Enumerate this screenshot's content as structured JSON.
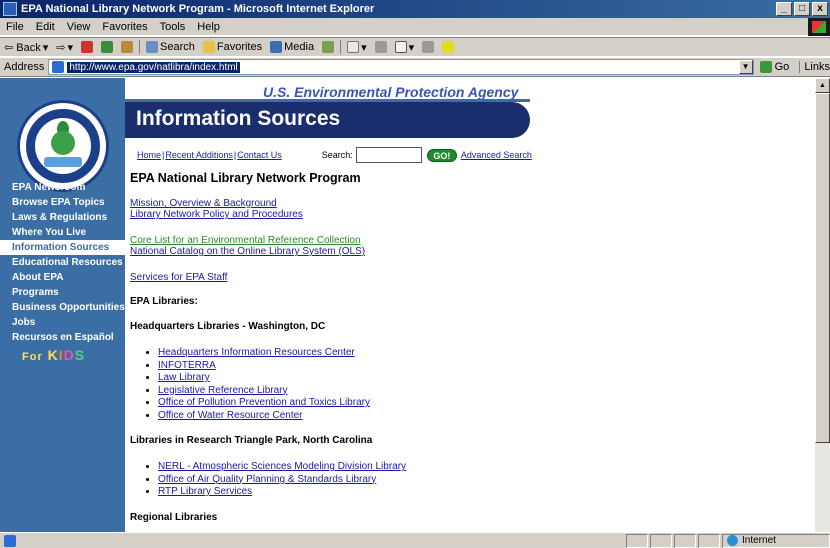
{
  "window": {
    "title": "EPA National Library Network Program - Microsoft Internet Explorer",
    "controls": [
      "_",
      "□",
      "x"
    ]
  },
  "menu": [
    "File",
    "Edit",
    "View",
    "Favorites",
    "Tools",
    "Help"
  ],
  "toolbar": {
    "back": "⇦ Back",
    "forward": "⇨",
    "search": "Search",
    "favorites": "Favorites",
    "media": "Media"
  },
  "address": {
    "label": "Address",
    "url": "http://www.epa.gov/natlibra/index.html",
    "go": "Go",
    "links": "Links"
  },
  "site": {
    "agency": "U.S. Environmental Protection Agency",
    "banner": "Information Sources",
    "topnav": [
      "Home",
      "Recent Additions",
      "Contact Us"
    ],
    "search_label": "Search:",
    "search_value": "",
    "go_button": "GO!",
    "advanced_search": "Advanced Search",
    "kids_prefix": "For",
    "kids_word": "KIDS"
  },
  "sidebar": {
    "items": [
      {
        "label": "EPA Newsroom"
      },
      {
        "label": "Browse EPA Topics"
      },
      {
        "label": "Laws & Regulations"
      },
      {
        "label": "Where You Live"
      },
      {
        "label": "Information Sources"
      },
      {
        "label": "Educational Resources"
      },
      {
        "label": "About EPA"
      },
      {
        "label": "Programs"
      },
      {
        "label": "Business Opportunities"
      },
      {
        "label": "Jobs"
      },
      {
        "label": "Recursos en Español"
      }
    ]
  },
  "main": {
    "title": "EPA National Library Network Program",
    "links_a": [
      "Mission, Overview & Background",
      "Library Network Policy and Procedures"
    ],
    "links_b": [
      "Core List for an Environmental Reference Collection",
      "National Catalog on the Online Library System (OLS)"
    ],
    "services": "Services for EPA Staff",
    "libraries_heading": "EPA Libraries:",
    "hq_heading": "Headquarters Libraries - Washington, DC",
    "hq_list": [
      "Headquarters Information Resources Center",
      "INFOTERRA",
      "Law Library",
      "Legislative Reference Library",
      "Office of Pollution Prevention and Toxics Library",
      "Office of Water Resource Center"
    ],
    "rtp_heading": "Libraries in Research Triangle Park, North Carolina",
    "rtp_list": [
      "NERL - Atmospheric Sciences Modeling Division Library",
      "Office of Air Quality Planning & Standards Library",
      "RTP Library Services"
    ],
    "regional_heading": "Regional Libraries"
  },
  "status": {
    "zone": "Internet"
  }
}
